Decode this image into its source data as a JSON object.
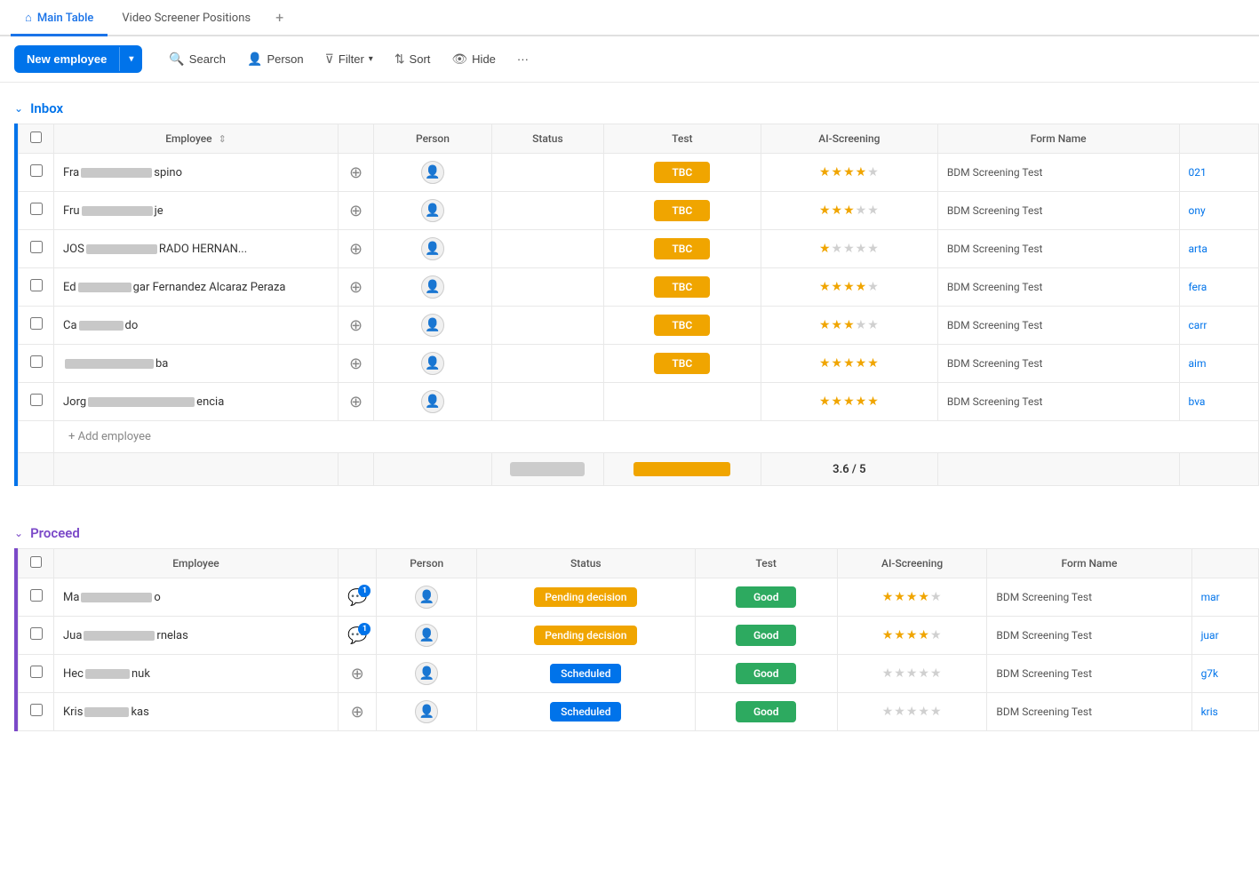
{
  "tabs": [
    {
      "label": "Main Table",
      "active": true,
      "icon": "home"
    },
    {
      "label": "Video Screener Positions",
      "active": false
    }
  ],
  "tab_add": "+",
  "toolbar": {
    "new_employee_label": "New employee",
    "caret": "▾",
    "search_label": "Search",
    "person_label": "Person",
    "filter_label": "Filter",
    "sort_label": "Sort",
    "hide_label": "Hide",
    "more_label": "···"
  },
  "inbox": {
    "section_title": "Inbox",
    "columns": [
      "Employee",
      "Person",
      "Status",
      "Test",
      "AI-Screening",
      "Form Name"
    ],
    "rows": [
      {
        "name_visible": "Fra",
        "name_blur1_width": 80,
        "name_visible2": "spino",
        "action_icon": "⊕",
        "status": "",
        "test": "TBC",
        "stars": 4,
        "form_name": "BDM Screening Test",
        "link": "021"
      },
      {
        "name_visible": "Fru",
        "name_blur1_width": 80,
        "name_visible2": "je",
        "action_icon": "⊕",
        "status": "",
        "test": "TBC",
        "stars": 3,
        "form_name": "BDM Screening Test",
        "link": "ony"
      },
      {
        "name_visible": "JOS",
        "name_blur1_width": 80,
        "name_visible2": "RADO HERNAN...",
        "action_icon": "⊕",
        "status": "",
        "test": "TBC",
        "stars": 1,
        "form_name": "BDM Screening Test",
        "link": "arta"
      },
      {
        "name_visible": "Ed",
        "name_blur1_width": 60,
        "name_visible2": "gar Fernandez Alcaraz Peraza",
        "action_icon": "⊕",
        "status": "",
        "test": "TBC",
        "stars": 4,
        "form_name": "BDM Screening Test",
        "link": "fera"
      },
      {
        "name_visible": "Ca",
        "name_blur1_width": 50,
        "name_visible2": "do",
        "action_icon": "⊕",
        "status": "",
        "test": "TBC",
        "stars": 3,
        "form_name": "BDM Screening Test",
        "link": "carr"
      },
      {
        "name_visible": "",
        "name_blur1_width": 100,
        "name_visible2": "ba",
        "action_icon": "⊕",
        "status": "",
        "test": "TBC",
        "stars": 5,
        "form_name": "BDM Screening Test",
        "link": "aim"
      },
      {
        "name_visible": "Jorg",
        "name_blur1_width": 120,
        "name_visible2": "encia",
        "action_icon": "⊕",
        "status": "",
        "test": "",
        "stars": 5,
        "form_name": "BDM Screening Test",
        "link": "bva"
      }
    ],
    "add_row_label": "+ Add employee",
    "summary_score": "3.6 / 5"
  },
  "proceed": {
    "section_title": "Proceed",
    "columns": [
      "Employee",
      "Person",
      "Status",
      "Test",
      "AI-Screening",
      "Form Name"
    ],
    "rows": [
      {
        "name_visible": "Ma",
        "name_blur1_width": 80,
        "name_visible2": "o",
        "action_icon": "notify",
        "status": "Pending decision",
        "status_class": "status-pending",
        "test": "Good",
        "stars": 4,
        "form_name": "BDM Screening Test",
        "link": "mar"
      },
      {
        "name_visible": "Jua",
        "name_blur1_width": 80,
        "name_visible2": "rnelas",
        "action_icon": "notify",
        "status": "Pending decision",
        "status_class": "status-pending",
        "test": "Good",
        "stars": 4,
        "form_name": "BDM Screening Test",
        "link": "juar"
      },
      {
        "name_visible": "Hec",
        "name_blur1_width": 50,
        "name_visible2": "nuk",
        "action_icon": "⊕",
        "status": "Scheduled",
        "status_class": "status-scheduled",
        "test": "Good",
        "stars": 0,
        "form_name": "BDM Screening Test",
        "link": "g7k"
      },
      {
        "name_visible": "Kris",
        "name_blur1_width": 50,
        "name_visible2": "kas",
        "action_icon": "⊕",
        "status": "Scheduled",
        "status_class": "status-scheduled",
        "test": "Good",
        "stars": 0,
        "form_name": "BDM Screening Test",
        "link": "kris"
      }
    ]
  },
  "colors": {
    "inbox_border": "#0073ea",
    "proceed_border": "#7b49c8",
    "tbc_color": "#f0a500",
    "good_color": "#2daa60",
    "pending_color": "#f0a500",
    "scheduled_color": "#0073ea"
  }
}
